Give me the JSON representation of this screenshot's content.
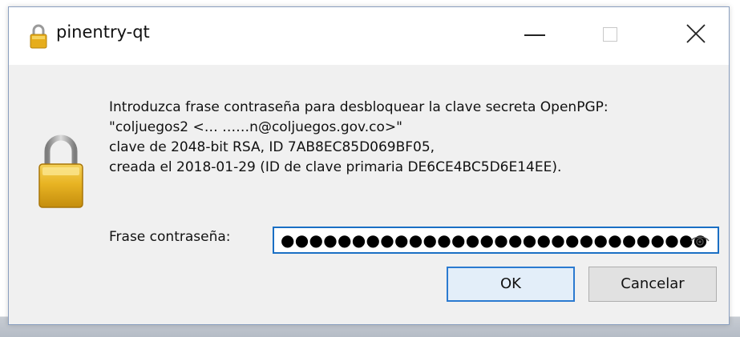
{
  "window": {
    "title": "pinentry-qt",
    "controls": {
      "minimize": "minimize-icon",
      "maximize": "maximize-icon",
      "close": "close-icon"
    }
  },
  "message": {
    "lines": [
      "Introduzca frase contraseña para desbloquear la clave secreta OpenPGP:",
      "\"coljuegos2 <… ……n@coljuegos.gov.co>\"",
      "clave de 2048-bit RSA, ID 7AB8EC85D069BF05,",
      "creada el 2018-01-29 (ID de clave primaria DE6CE4BC5D6E14EE)."
    ]
  },
  "passphrase": {
    "label": "Frase contraseña:",
    "masked_value": "●●●●●●●●●●●●●●●●●●●●●●●●●●●●●●",
    "reveal_icon": "eye-icon"
  },
  "buttons": {
    "ok": "OK",
    "cancel": "Cancelar"
  },
  "colors": {
    "accent": "#1a6fc4",
    "lock_gold": "#e8b423",
    "window_bg": "#f0f0f0"
  }
}
